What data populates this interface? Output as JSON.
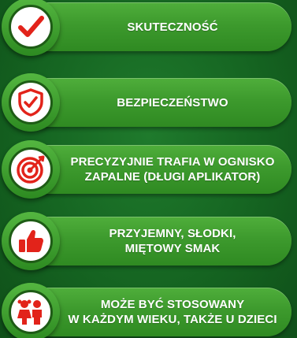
{
  "features": [
    {
      "icon": "checkmark-icon",
      "lines": [
        "SKUTECZNOŚĆ"
      ]
    },
    {
      "icon": "shield-check-icon",
      "lines": [
        "BEZPIECZEŃSTWO"
      ]
    },
    {
      "icon": "target-icon",
      "lines": [
        "PRECYZYJNIE TRAFIA W OGNISKO",
        "ZAPALNE (DŁUGI APLIKATOR)"
      ]
    },
    {
      "icon": "thumbs-up-icon",
      "lines": [
        "PRZYJEMNY, SŁODKI,",
        "MIĘTOWY SMAK"
      ]
    },
    {
      "icon": "children-icon",
      "lines": [
        "MOŻE BYĆ STOSOWANY",
        "W KAŻDYM WIEKU, TAKŻE U DZIECI"
      ]
    }
  ],
  "colors": {
    "accent_red": "#e2231a",
    "pill_green": "#3d9a2d",
    "background_green": "#156421"
  }
}
